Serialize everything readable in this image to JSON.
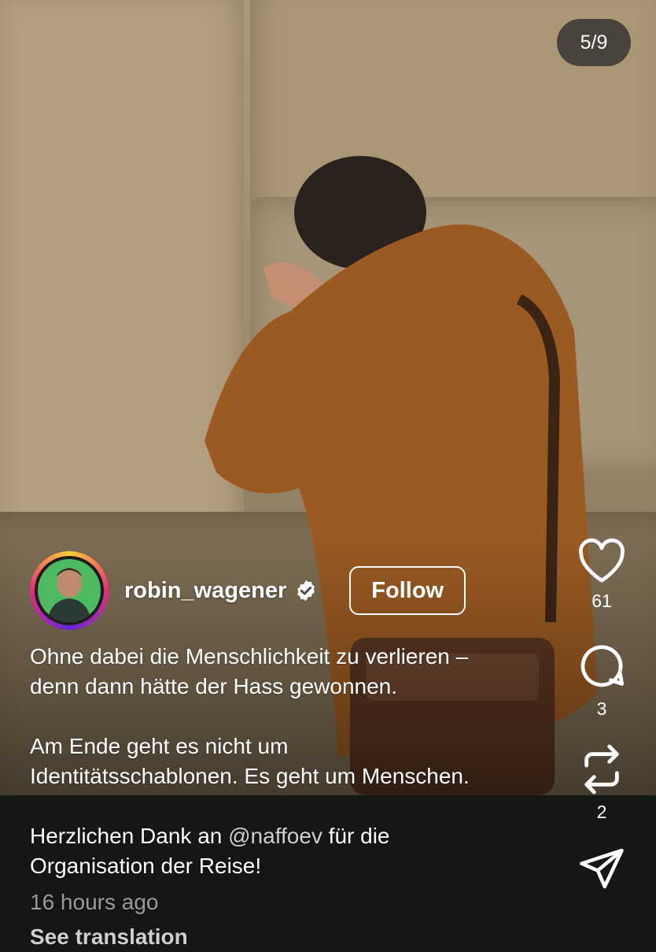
{
  "carousel": {
    "counter": "5/9"
  },
  "author": {
    "username": "robin_wagener",
    "follow_label": "Follow"
  },
  "caption": {
    "line1": "Ohne dabei die Menschlichkeit zu verlieren –",
    "line2": "denn dann hätte der Hass gewonnen.",
    "line3": "Am Ende geht es nicht um",
    "line4": "Identitätsschablonen. Es geht um Menschen.",
    "line5_pre": "Herzlichen Dank an ",
    "mention": "@naffoev",
    "line5_post": " für die",
    "line6": "Organisation der Reise!",
    "timestamp": "16 hours ago",
    "see_translation": "See translation"
  },
  "actions": {
    "likes": "61",
    "comments": "3",
    "reposts": "2"
  },
  "colors": {
    "panel": "#151617",
    "avatar_bg": "#4dba62",
    "verified": "#ffffff"
  }
}
